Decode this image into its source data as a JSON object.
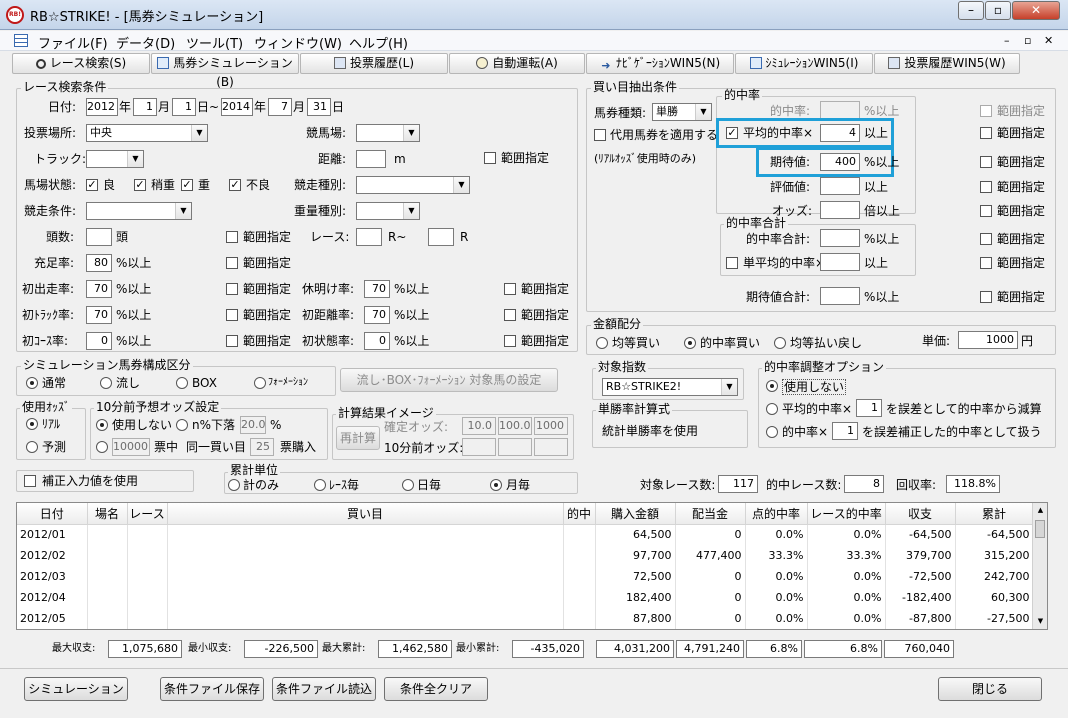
{
  "window": {
    "title": "RB☆STRIKE! - [馬券シミュレーション]",
    "icon_text": "RB!",
    "min": "–",
    "restore": "▫",
    "close": "✕"
  },
  "menu": [
    "ファイル(F)",
    "データ(D)",
    "ツール(T)",
    "ウィンドウ(W)",
    "ヘルプ(H)"
  ],
  "mdi": {
    "min": "–",
    "restore": "▫",
    "close": "✕"
  },
  "tabs": [
    "レース検索(S)",
    "馬券シミュレーション(B)",
    "投票履歴(L)",
    "自動運転(A)",
    "ﾅﾋﾞｹﾞｰｼｮﾝWIN5(N)",
    "ｼﾐｭﾚｰｼｮﾝWIN5(I)",
    "投票履歴WIN5(W)"
  ],
  "race": {
    "title": "レース検索条件",
    "date_label": "日付:",
    "y1": "2012",
    "m1": "1",
    "d1": "1",
    "y2": "2014",
    "m2": "7",
    "d2": "31",
    "u_year": "年",
    "u_month": "月",
    "u_day_to": "日~",
    "u_day": "日",
    "venue_label": "投票場所:",
    "venue": "中央",
    "course_label": "競馬場:",
    "track_label": "トラック:",
    "dist_label": "距離:",
    "dist_unit": "m",
    "range": "範囲指定",
    "cond_label": "馬場状態:",
    "c_good": "良",
    "c_slight": "稍重",
    "c_heavy": "重",
    "c_bad": "不良",
    "racetype_label": "競走種別:",
    "racecond_label": "競走条件:",
    "weight_label": "重量種別:",
    "heads_label": "頭数:",
    "heads_unit": "頭",
    "race_label": "レース:",
    "race_unit1": "R~",
    "race_unit2": "R",
    "fill_label": "充足率:",
    "fill": "80",
    "pct_ge": "%以上",
    "first_label": "初出走率:",
    "first": "70",
    "rest_label": "休明け率:",
    "rest": "70",
    "ftrack_label": "初ﾄﾗｯｸ率:",
    "ftrack": "70",
    "fdist_label": "初距離率:",
    "fdist": "70",
    "fcourse_label": "初ｺｰｽ率:",
    "fcourse": "0",
    "fstate_label": "初状態率:",
    "fstate": "0"
  },
  "simcomp": {
    "title": "シミュレーション馬券構成区分",
    "o1": "通常",
    "o2": "流し",
    "o3": "BOX",
    "o4": "ﾌｫｰﾒｰｼｮﾝ",
    "btn": "流し･BOX･ﾌｫｰﾒｰｼｮﾝ 対象馬の設定"
  },
  "oddsuse": {
    "title": "使用ｵｯｽﾞ",
    "o1": "ﾘｱﾙ",
    "o2": "予測"
  },
  "pre10": {
    "title": "10分前予想オッズ設定",
    "o1": "使用しない",
    "o2": "n%下落",
    "pct": "20.0",
    "pct_unit": "%",
    "n": "10000",
    "t1": "票中",
    "t2": "同一買い目",
    "n2": "25",
    "t3": "票購入"
  },
  "calc": {
    "title": "計算結果イメージ",
    "btn": "再計算",
    "l1": "確定オッズ:",
    "v1": "10.0",
    "v2": "100.0",
    "v3": "1000",
    "l2": "10分前オッズ:"
  },
  "correct": {
    "label": "補正入力値を使用"
  },
  "agg": {
    "title": "累計単位",
    "o1": "計のみ",
    "o2": "ﾚｰｽ毎",
    "o3": "日毎",
    "o4": "月毎"
  },
  "buy": {
    "title": "買い目抽出条件",
    "kind_label": "馬券種類:",
    "kind": "単勝",
    "subst": "代用馬券を適用する",
    "realodds": "(ﾘｱﾙｵｯｽﾞ使用時のみ)",
    "hit_title": "的中率",
    "hitrate": "的中率:",
    "avg": "平均的中率×",
    "avg_v": "4",
    "ge": "以上",
    "pct_ge": "%以上",
    "ev": "期待値:",
    "ev_v": "400",
    "score": "評価値:",
    "odds": "オッズ:",
    "times_ge": "倍以上",
    "sum_title": "的中率合計",
    "hitsum": "的中率合計:",
    "singleavg": "単平均的中率×",
    "evsum": "期待値合計:",
    "range": "範囲指定"
  },
  "alloc": {
    "title": "金額配分",
    "o1": "均等買い",
    "o2": "的中率買い",
    "o3": "均等払い戻し",
    "unit_label": "単価:",
    "unit": "1000",
    "yen": "円"
  },
  "target": {
    "title": "対象指数",
    "value": "RB☆STRIKE2!"
  },
  "single": {
    "title": "単勝率計算式",
    "text": "統計単勝率を使用"
  },
  "adj": {
    "title": "的中率調整オプション",
    "o1": "使用しない",
    "o2a": "平均的中率×",
    "o2b": "を誤差として的中率から減算",
    "v2": "1",
    "o3a": "的中率×",
    "o3b": "を誤差補正した的中率として扱う",
    "v3": "1"
  },
  "stats": {
    "races_label": "対象レース数:",
    "races": "117",
    "hits_label": "的中レース数:",
    "hits": "8",
    "ret_label": "回収率:",
    "ret": "118.8%"
  },
  "table": {
    "headers": [
      "日付",
      "場名",
      "レース",
      "買い目",
      "的中",
      "購入金額",
      "配当金",
      "点的中率",
      "レース的中率",
      "収支",
      "累計"
    ],
    "rows": [
      [
        "2012/01",
        "",
        "",
        "",
        "",
        "64,500",
        "0",
        "0.0%",
        "0.0%",
        "-64,500",
        "-64,500"
      ],
      [
        "2012/02",
        "",
        "",
        "",
        "",
        "97,700",
        "477,400",
        "33.3%",
        "33.3%",
        "379,700",
        "315,200"
      ],
      [
        "2012/03",
        "",
        "",
        "",
        "",
        "72,500",
        "0",
        "0.0%",
        "0.0%",
        "-72,500",
        "242,700"
      ],
      [
        "2012/04",
        "",
        "",
        "",
        "",
        "182,400",
        "0",
        "0.0%",
        "0.0%",
        "-182,400",
        "60,300"
      ],
      [
        "2012/05",
        "",
        "",
        "",
        "",
        "87,800",
        "0",
        "0.0%",
        "0.0%",
        "-87,800",
        "-27,500"
      ]
    ]
  },
  "summary": {
    "max_label": "最大収支:",
    "max": "1,075,680",
    "min_label": "最小収支:",
    "min": "-226,500",
    "maxcum_label": "最大累計:",
    "maxcum": "1,462,580",
    "mincum_label": "最小累計:",
    "mincum": "-435,020",
    "buy": "4,031,200",
    "pay": "4,791,240",
    "rate1": "6.8%",
    "rate2": "6.8%",
    "bal": "760,040"
  },
  "buttons": {
    "sim": "シミュレーション",
    "save": "条件ファイル保存",
    "load": "条件ファイル読込",
    "clear": "条件全クリア",
    "close": "閉じる"
  },
  "check": "✓",
  "arrow": "▼"
}
